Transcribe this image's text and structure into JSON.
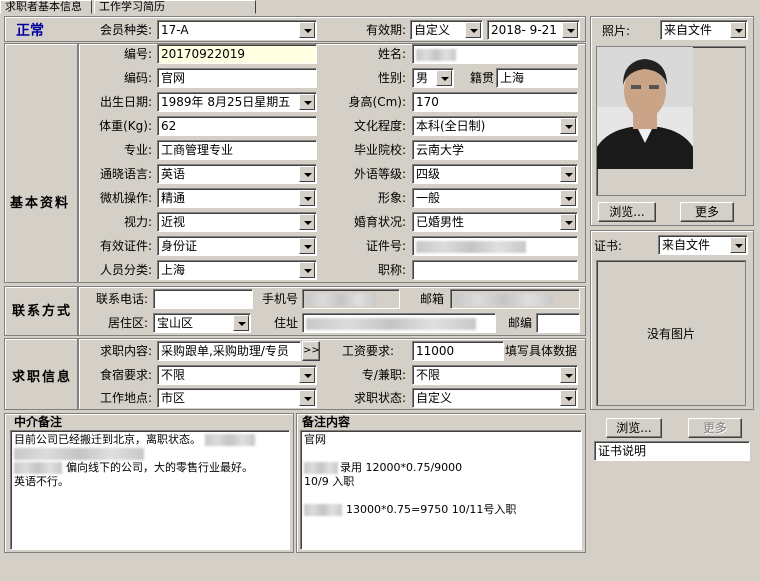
{
  "tabs": [
    "求职者基本信息",
    "工作学习简历"
  ],
  "status": "正常",
  "member": {
    "type_label": "会员种类:",
    "type_value": "17-A",
    "valid_label": "有效期:",
    "valid_mode": "自定义",
    "valid_date": "2018- 9-21"
  },
  "photo": {
    "label": "照片:",
    "source": "来自文件",
    "browse": "浏览...",
    "more": "更多"
  },
  "cert": {
    "label": "证书:",
    "source": "来自文件",
    "no_image": "没有图片",
    "browse": "浏览...",
    "more": "更多",
    "desc": "证书说明"
  },
  "basic": {
    "section": "基本资料",
    "id_label": "编号:",
    "id_value": "20170922019",
    "name_label": "姓名:",
    "code_label": "编码:",
    "code_value": "官网",
    "gender_label": "性别:",
    "gender_value": "男",
    "origin_label": "籍贯",
    "origin_value": "上海",
    "birth_label": "出生日期:",
    "birth_value": "1989年 8月25日星期五",
    "height_label": "身高(Cm):",
    "height_value": "170",
    "weight_label": "体重(Kg):",
    "weight_value": "62",
    "edu_label": "文化程度:",
    "edu_value": "本科(全日制)",
    "major_label": "专业:",
    "major_value": "工商管理专业",
    "school_label": "毕业院校:",
    "school_value": "云南大学",
    "lang_label": "通晓语言:",
    "lang_value": "英语",
    "lang_level_label": "外语等级:",
    "lang_level_value": "四级",
    "pc_label": "微机操作:",
    "pc_value": "精通",
    "image_label": "形象:",
    "image_value": "一般",
    "vision_label": "视力:",
    "vision_value": "近视",
    "marital_label": "婚育状况:",
    "marital_value": "已婚男性",
    "doc_label": "有效证件:",
    "doc_value": "身份证",
    "doc_no_label": "证件号:",
    "category_label": "人员分类:",
    "category_value": "上海",
    "title_label": "职称:"
  },
  "contact": {
    "section": "联系方式",
    "phone_label": "联系电话:",
    "mobile_label": "手机号",
    "email_label": "邮箱",
    "district_label": "居住区:",
    "district_value": "宝山区",
    "address_label": "住址",
    "zip_label": "邮编"
  },
  "job": {
    "section": "求职信息",
    "content_label": "求职内容:",
    "content_value": "采购跟单,采购助理/专员",
    "more_btn": ">>",
    "salary_label": "工资要求:",
    "salary_value": "11000",
    "salary_hint": "填写具体数据",
    "board_label": "食宿要求:",
    "board_value": "不限",
    "parttime_label": "专/兼职:",
    "parttime_value": "不限",
    "location_label": "工作地点:",
    "location_value": "市区",
    "state_label": "求职状态:",
    "state_value": "自定义"
  },
  "agent_notes": {
    "title": "中介备注",
    "lines": [
      "目前公司已经搬迁到北京，离职状态。",
      "",
      "偏向线下的公司，大的零售行业最好。",
      "英语不行。"
    ]
  },
  "remarks": {
    "title": "备注内容",
    "lines": [
      "官网",
      "",
      "录用 12000*0.75/9000",
      "10/9 入职",
      "",
      "13000*0.75=9750 10/11号入职"
    ]
  }
}
